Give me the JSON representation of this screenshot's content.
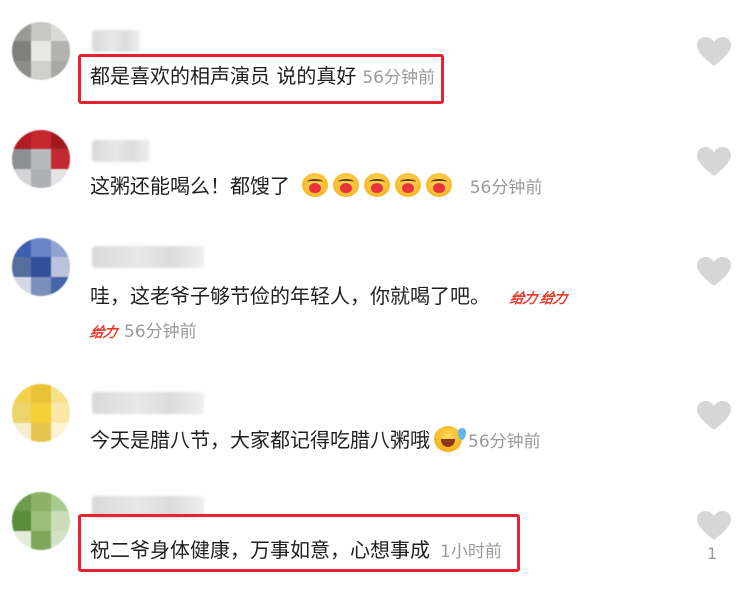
{
  "comments": [
    {
      "text": "都是喜欢的相声演员 说的真好",
      "time": "56分钟前",
      "likes": "",
      "avatar_colors": [
        "#9a9a96",
        "#c6c6c2",
        "#d9d9d6",
        "#7f807c",
        "#e7e7e4",
        "#b2b3af",
        "#8c8d88",
        "#cfcfcc",
        "#a7a8a4"
      ]
    },
    {
      "text": "这粥还能喝么！都馊了",
      "time": "56分钟前",
      "likes": "",
      "emoji_count": 5,
      "avatar_colors": [
        "#b01c22",
        "#c62830",
        "#9f1a1f",
        "#8e8f92",
        "#b8b9bc",
        "#c12a2f",
        "#d4d4d6",
        "#aeb0b3",
        "#e4e4e6"
      ]
    },
    {
      "text": "哇，这老爷子够节俭的年轻人，你就喝了吧。",
      "emoji_text": "给力",
      "time": "56分钟前",
      "likes": "",
      "avatar_colors": [
        "#3c5fb0",
        "#6a86c8",
        "#8fa3d0",
        "#556e9d",
        "#324f9a",
        "#b9c3dc",
        "#d5d9e4",
        "#7b8fbd",
        "#4664a8"
      ]
    },
    {
      "text": "今天是腊八节，大家都记得吃腊八粥哦",
      "time": "56分钟前",
      "likes": "",
      "avatar_colors": [
        "#f2d24b",
        "#e9c238",
        "#f6e08a",
        "#ecd36a",
        "#f4cf36",
        "#fbe7a6",
        "#f7eed0",
        "#e6c64f",
        "#fdf4d6"
      ]
    },
    {
      "text": "祝二爷身体健康，万事如意，心想事成",
      "time": "1小时前",
      "likes": "1",
      "avatar_colors": [
        "#6c9b4a",
        "#8cb167",
        "#a9c98d",
        "#5b8c3c",
        "#9bbf78",
        "#c9ddb8",
        "#e2ecd8",
        "#7fa75a",
        "#d2e3c4"
      ]
    }
  ],
  "icons": {
    "like": "heart-outline-icon",
    "emoji_heart": "heart-kiss-emoji-icon",
    "emoji_laugh": "laugh-tears-emoji-icon",
    "emoji_geili": "geili-sticker-icon"
  },
  "colors": {
    "highlight": "#e8222f",
    "time": "#9a9a9a",
    "like_icon": "#d6d6d6"
  }
}
